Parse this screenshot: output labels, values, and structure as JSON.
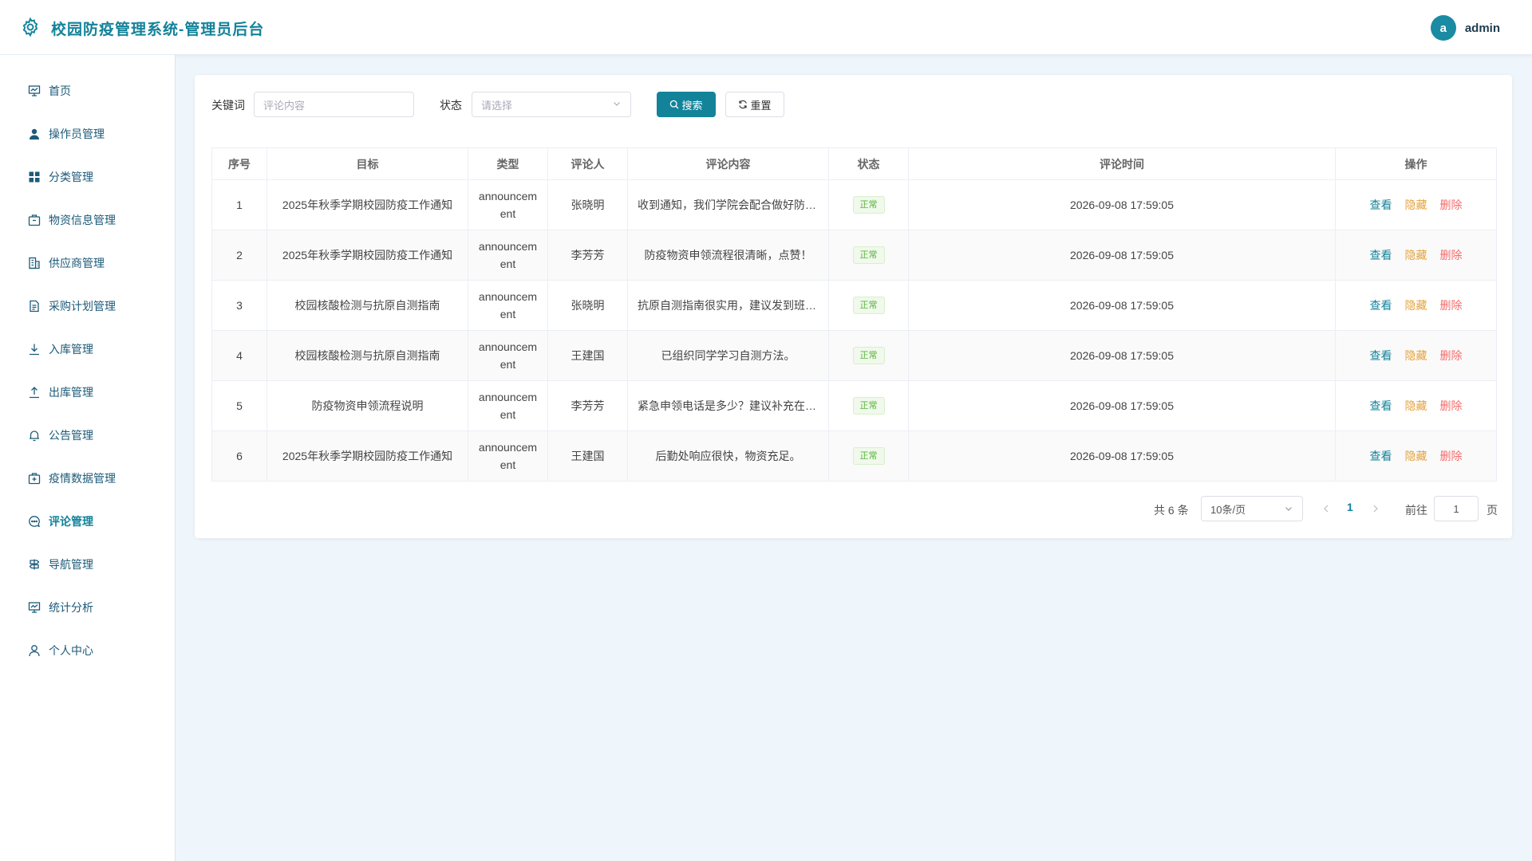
{
  "app": {
    "title": "校园防疫管理系统-管理员后台"
  },
  "user": {
    "avatar_letter": "a",
    "name": "admin"
  },
  "sidebar": {
    "items": [
      {
        "label": "首页",
        "icon": "dashboard-icon"
      },
      {
        "label": "操作员管理",
        "icon": "user-icon"
      },
      {
        "label": "分类管理",
        "icon": "grid-icon"
      },
      {
        "label": "物资信息管理",
        "icon": "box-icon"
      },
      {
        "label": "供应商管理",
        "icon": "building-icon"
      },
      {
        "label": "采购计划管理",
        "icon": "document-icon"
      },
      {
        "label": "入库管理",
        "icon": "download-icon"
      },
      {
        "label": "出库管理",
        "icon": "upload-icon"
      },
      {
        "label": "公告管理",
        "icon": "bell-icon"
      },
      {
        "label": "疫情数据管理",
        "icon": "medical-box-icon"
      },
      {
        "label": "评论管理",
        "icon": "chat-icon"
      },
      {
        "label": "导航管理",
        "icon": "guide-icon"
      },
      {
        "label": "统计分析",
        "icon": "chart-board-icon"
      },
      {
        "label": "个人中心",
        "icon": "person-icon"
      }
    ],
    "active": "评论管理"
  },
  "filters": {
    "keyword_label": "关键词",
    "keyword_placeholder": "评论内容",
    "status_label": "状态",
    "status_placeholder": "请选择",
    "search_label": "搜索",
    "reset_label": "重置"
  },
  "table": {
    "columns": [
      "序号",
      "目标",
      "类型",
      "评论人",
      "评论内容",
      "状态",
      "评论时间",
      "操作"
    ],
    "rows": [
      {
        "no": "1",
        "target": "2025年秋季学期校园防疫工作通知",
        "type": [
          "announcem",
          "ent"
        ],
        "author": "张晓明",
        "content": "收到通知，我们学院会配合做好防疫工作",
        "status": "正常",
        "time": "2026-09-08 17:59:05"
      },
      {
        "no": "2",
        "target": "2025年秋季学期校园防疫工作通知",
        "type": [
          "announcem",
          "ent"
        ],
        "author": "李芳芳",
        "content": "防疫物资申领流程很清晰，点赞！",
        "status": "正常",
        "time": "2026-09-08 17:59:05"
      },
      {
        "no": "3",
        "target": "校园核酸检测与抗原自测指南",
        "type": [
          "announcem",
          "ent"
        ],
        "author": "张晓明",
        "content": "抗原自测指南很实用，建议发到班级群",
        "status": "正常",
        "time": "2026-09-08 17:59:05"
      },
      {
        "no": "4",
        "target": "校园核酸检测与抗原自测指南",
        "type": [
          "announcem",
          "ent"
        ],
        "author": "王建国",
        "content": "已组织同学学习自测方法。",
        "status": "正常",
        "time": "2026-09-08 17:59:05"
      },
      {
        "no": "5",
        "target": "防疫物资申领流程说明",
        "type": [
          "announcem",
          "ent"
        ],
        "author": "李芳芳",
        "content": "紧急申领电话是多少？建议补充在说明中",
        "status": "正常",
        "time": "2026-09-08 17:59:05"
      },
      {
        "no": "6",
        "target": "2025年秋季学期校园防疫工作通知",
        "type": [
          "announcem",
          "ent"
        ],
        "author": "王建国",
        "content": "后勤处响应很快，物资充足。",
        "status": "正常",
        "time": "2026-09-08 17:59:05"
      }
    ],
    "actions": {
      "view": "查看",
      "hide": "隐藏",
      "delete": "删除"
    }
  },
  "pagination": {
    "total_text": "共 6 条",
    "page_size": "10条/页",
    "current_page": "1",
    "goto_label": "前往",
    "goto_value": "1",
    "page_unit": "页"
  },
  "colors": {
    "accent": "#13839a",
    "warning": "#e6a23c",
    "danger": "#f56c6c",
    "success": "#56b43b"
  }
}
